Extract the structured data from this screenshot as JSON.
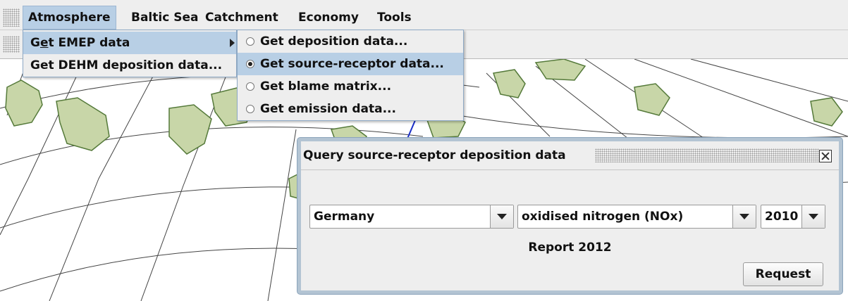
{
  "menubar": {
    "items": [
      {
        "label": "Atmosphere",
        "active": true
      },
      {
        "label": "Baltic Sea"
      },
      {
        "label": "Catchment"
      },
      {
        "label": "Economy"
      },
      {
        "label": "Tools"
      }
    ]
  },
  "atmosphere_menu": {
    "items": [
      {
        "label_pre": "G",
        "label_mnemonic": "e",
        "label_post": "t EMEP data",
        "has_submenu": true,
        "highlighted": true
      },
      {
        "label": "Get DEHM deposition data..."
      }
    ]
  },
  "emep_submenu": {
    "items": [
      {
        "label": "Get deposition data...",
        "selected": false
      },
      {
        "label": "Get source-receptor data...",
        "selected": true,
        "highlighted": true
      },
      {
        "label": "Get blame matrix...",
        "selected": false
      },
      {
        "label": "Get emission data...",
        "selected": false
      }
    ]
  },
  "dialog": {
    "title": "Query source-receptor deposition data",
    "country": {
      "value": "Germany"
    },
    "compound": {
      "value": "oxidised nitrogen (NOx)"
    },
    "year": {
      "value": "2010"
    },
    "report_label": "Report 2012",
    "request_button": "Request"
  },
  "colors": {
    "menu_highlight": "#b8cfe5",
    "land": "#c8d6a8",
    "coast": "#557a3a",
    "grid_lines": "#444444",
    "meridian_accent": "#1a2ec8"
  },
  "icons": [
    "radio-button-icon",
    "submenu-arrow-icon",
    "combo-arrow-icon",
    "close-icon"
  ]
}
